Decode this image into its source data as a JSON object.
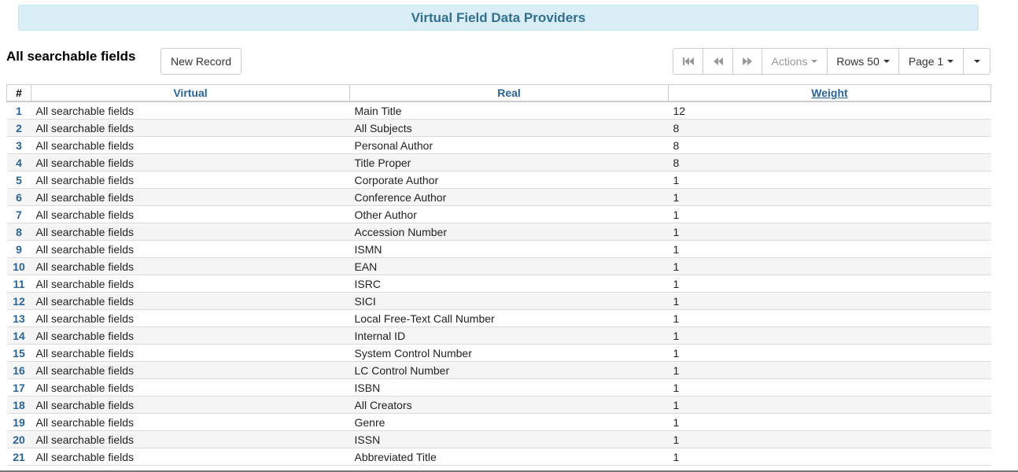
{
  "page": {
    "title": "Virtual Field Data Providers",
    "subtitle": "All searchable fields"
  },
  "buttons": {
    "new_record": "New Record"
  },
  "toolbar": {
    "first_icon": "first-page-icon",
    "prev_icon": "previous-page-icon",
    "next_icon": "next-page-icon",
    "actions": "Actions",
    "rows": "Rows 50",
    "page": "Page 1",
    "more_icon": "caret-down-icon"
  },
  "table": {
    "headers": {
      "num": "#",
      "virtual": "Virtual",
      "real": "Real",
      "weight": "Weight"
    },
    "rows": [
      {
        "n": "1",
        "virtual": "All searchable fields",
        "real": "Main Title",
        "weight": "12"
      },
      {
        "n": "2",
        "virtual": "All searchable fields",
        "real": "All Subjects",
        "weight": "8"
      },
      {
        "n": "3",
        "virtual": "All searchable fields",
        "real": "Personal Author",
        "weight": "8"
      },
      {
        "n": "4",
        "virtual": "All searchable fields",
        "real": "Title Proper",
        "weight": "8"
      },
      {
        "n": "5",
        "virtual": "All searchable fields",
        "real": "Corporate Author",
        "weight": "1"
      },
      {
        "n": "6",
        "virtual": "All searchable fields",
        "real": "Conference Author",
        "weight": "1"
      },
      {
        "n": "7",
        "virtual": "All searchable fields",
        "real": "Other Author",
        "weight": "1"
      },
      {
        "n": "8",
        "virtual": "All searchable fields",
        "real": "Accession Number",
        "weight": "1"
      },
      {
        "n": "9",
        "virtual": "All searchable fields",
        "real": "ISMN",
        "weight": "1"
      },
      {
        "n": "10",
        "virtual": "All searchable fields",
        "real": "EAN",
        "weight": "1"
      },
      {
        "n": "11",
        "virtual": "All searchable fields",
        "real": "ISRC",
        "weight": "1"
      },
      {
        "n": "12",
        "virtual": "All searchable fields",
        "real": "SICI",
        "weight": "1"
      },
      {
        "n": "13",
        "virtual": "All searchable fields",
        "real": "Local Free-Text Call Number",
        "weight": "1"
      },
      {
        "n": "14",
        "virtual": "All searchable fields",
        "real": "Internal ID",
        "weight": "1"
      },
      {
        "n": "15",
        "virtual": "All searchable fields",
        "real": "System Control Number",
        "weight": "1"
      },
      {
        "n": "16",
        "virtual": "All searchable fields",
        "real": "LC Control Number",
        "weight": "1"
      },
      {
        "n": "17",
        "virtual": "All searchable fields",
        "real": "ISBN",
        "weight": "1"
      },
      {
        "n": "18",
        "virtual": "All searchable fields",
        "real": "All Creators",
        "weight": "1"
      },
      {
        "n": "19",
        "virtual": "All searchable fields",
        "real": "Genre",
        "weight": "1"
      },
      {
        "n": "20",
        "virtual": "All searchable fields",
        "real": "ISSN",
        "weight": "1"
      },
      {
        "n": "21",
        "virtual": "All searchable fields",
        "real": "Abbreviated Title",
        "weight": "1"
      }
    ]
  }
}
